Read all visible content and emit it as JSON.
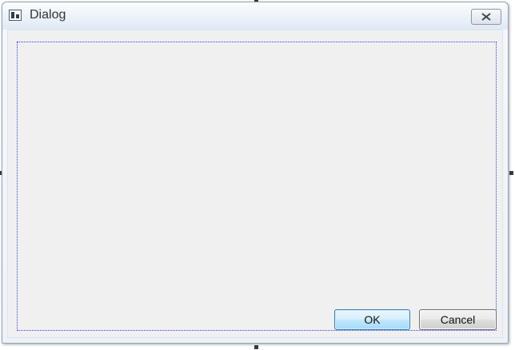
{
  "window": {
    "title": "Dialog",
    "icon": "app-window-icon"
  },
  "titlebar": {
    "close_icon": "close-icon"
  },
  "buttons": {
    "ok_label": "OK",
    "cancel_label": "Cancel"
  },
  "colors": {
    "layout_outline": "#2b44d8",
    "client_background": "#f1f0f1",
    "ok_button_border": "#3c7fb1"
  }
}
